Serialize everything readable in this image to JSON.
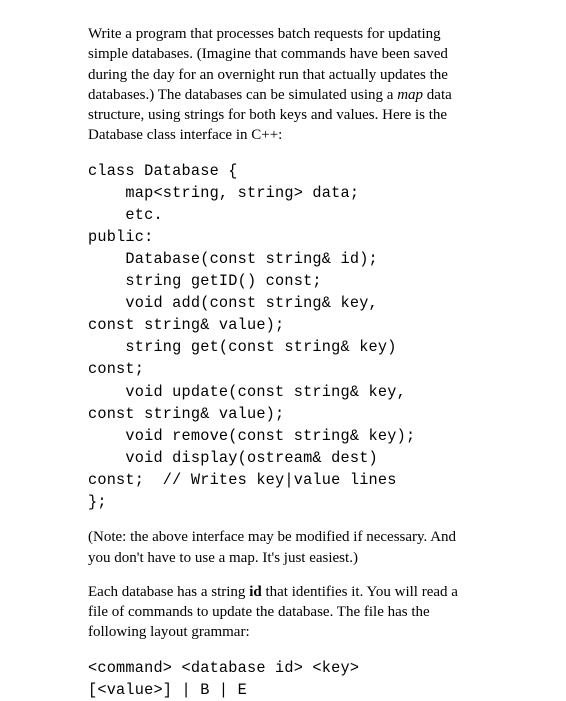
{
  "para1_a": "Write a program that processes batch requests for updating simple databases. (Imagine that commands have been saved during the day for an overnight run that actually updates the databases.) The databases can be simulated using a ",
  "para1_map": "map",
  "para1_b": " data structure, using strings for both keys and values. Here is the Database class interface in C++:",
  "code1": "class Database {\n    map<string, string> data;\n    etc.\npublic:\n    Database(const string& id);\n    string getID() const;\n    void add(const string& key,\nconst string& value);\n    string get(const string& key)\nconst;\n    void update(const string& key,\nconst string& value);\n    void remove(const string& key);\n    void display(ostream& dest)\nconst;  // Writes key|value lines\n};",
  "para2": "(Note: the above interface may be modified if necessary. And you don't have to use a map. It's just easiest.)",
  "para3_a": "Each database has a string ",
  "para3_id": "id",
  "para3_b": " that identifies it. You will read a file of commands to update the database. The file has the following layout grammar:",
  "code2": "<command> <database id> <key>\n[<value>] | B | E"
}
